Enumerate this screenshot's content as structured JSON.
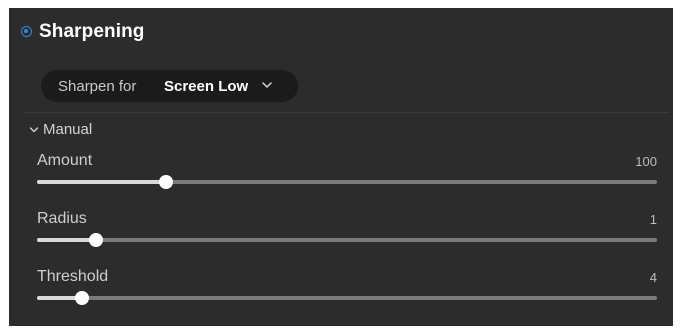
{
  "panel": {
    "title": "Sharpening",
    "enabled": true,
    "accent_color": "#2f86e0"
  },
  "sharpen_for": {
    "label": "Sharpen for",
    "value": "Screen Low",
    "icon": "chevron-down-icon"
  },
  "section": {
    "label": "Manual",
    "expanded": true,
    "icon": "chevron-down-icon"
  },
  "sliders": [
    {
      "label": "Amount",
      "value": "100",
      "position": 0.208
    },
    {
      "label": "Radius",
      "value": "1",
      "position": 0.095
    },
    {
      "label": "Threshold",
      "value": "4",
      "position": 0.073
    }
  ]
}
